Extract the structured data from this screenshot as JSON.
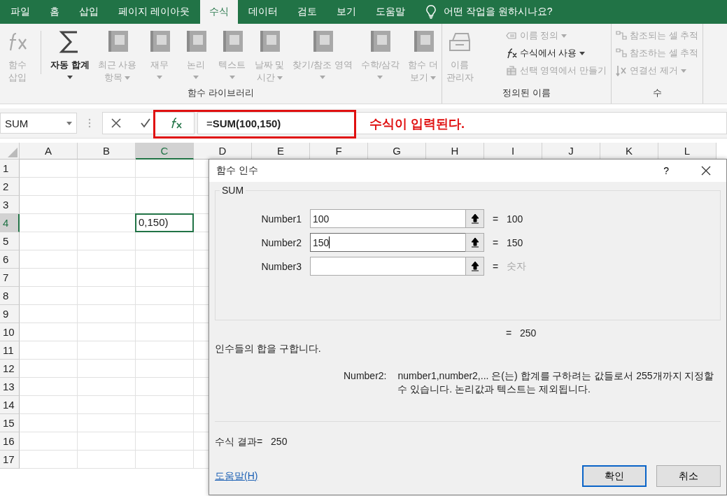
{
  "tabs": [
    {
      "label": "파일",
      "selected": false
    },
    {
      "label": "홈",
      "selected": false
    },
    {
      "label": "삽입",
      "selected": false
    },
    {
      "label": "페이지 레이아웃",
      "selected": false
    },
    {
      "label": "수식",
      "selected": true
    },
    {
      "label": "데이터",
      "selected": false
    },
    {
      "label": "검토",
      "selected": false
    },
    {
      "label": "보기",
      "selected": false
    },
    {
      "label": "도움말",
      "selected": false
    }
  ],
  "tell_me": {
    "placeholder": "어떤 작업을 원하시나요?"
  },
  "ribbon": {
    "groups": [
      {
        "label": "함수 라이브러리",
        "large": [
          {
            "kind": "fx",
            "lines": [
              "함수",
              "삽입"
            ],
            "dropdown": false,
            "disabled": true,
            "separator_after": true
          },
          {
            "kind": "sigma",
            "lines": [
              "자동 합계"
            ],
            "dropdown": true,
            "disabled": false,
            "separator_after": false
          },
          {
            "kind": "book",
            "lines": [
              "최근 사용",
              "항목"
            ],
            "dropdown": true,
            "disabled": true,
            "separator_after": false
          },
          {
            "kind": "book",
            "lines": [
              "재무"
            ],
            "dropdown": true,
            "disabled": true,
            "separator_after": false
          },
          {
            "kind": "book",
            "lines": [
              "논리"
            ],
            "dropdown": true,
            "disabled": true,
            "separator_after": false
          },
          {
            "kind": "book",
            "lines": [
              "텍스트"
            ],
            "dropdown": true,
            "disabled": true,
            "separator_after": false
          },
          {
            "kind": "book",
            "lines": [
              "날짜 및",
              "시간"
            ],
            "dropdown": true,
            "disabled": true,
            "separator_after": false
          },
          {
            "kind": "book",
            "lines": [
              "찾기/참조 영역"
            ],
            "dropdown": true,
            "disabled": true,
            "separator_after": false
          },
          {
            "kind": "book",
            "lines": [
              "수학/삼각"
            ],
            "dropdown": true,
            "disabled": true,
            "separator_after": false
          },
          {
            "kind": "book",
            "lines": [
              "함수 더",
              "보기"
            ],
            "dropdown": true,
            "disabled": true,
            "separator_after": false
          }
        ]
      },
      {
        "label": "정의된 이름",
        "large": [
          {
            "kind": "box",
            "lines": [
              "이름",
              "관리자"
            ],
            "dropdown": false,
            "disabled": true,
            "separator_after": false
          }
        ],
        "small": [
          {
            "kind": "tag",
            "label": "이름 정의",
            "dropdown": true,
            "disabled": true
          },
          {
            "kind": "fx",
            "label": "수식에서 사용",
            "dropdown": true,
            "disabled": false
          },
          {
            "kind": "grid",
            "label": "선택 영역에서 만들기",
            "dropdown": false,
            "disabled": true
          }
        ]
      },
      {
        "label": "수",
        "small": [
          {
            "kind": "trace",
            "label": "참조되는 셀 추적",
            "dropdown": false,
            "disabled": true
          },
          {
            "kind": "trace",
            "label": "참조하는 셀 추적",
            "dropdown": false,
            "disabled": true
          },
          {
            "kind": "remove",
            "label": "연결선 제거",
            "dropdown": true,
            "disabled": true
          }
        ]
      }
    ]
  },
  "formula_bar": {
    "name_box": "SUM",
    "formula": "=**SUM(100,150)**"
  },
  "annotation": {
    "text": "수식이 입력된다."
  },
  "sheet": {
    "columns": [
      {
        "label": "A",
        "selected": false
      },
      {
        "label": "B",
        "selected": false
      },
      {
        "label": "C",
        "selected": true
      },
      {
        "label": "D",
        "selected": false
      },
      {
        "label": "E",
        "selected": false
      },
      {
        "label": "F",
        "selected": false
      },
      {
        "label": "G",
        "selected": false
      },
      {
        "label": "H",
        "selected": false
      },
      {
        "label": "I",
        "selected": false
      },
      {
        "label": "J",
        "selected": false
      },
      {
        "label": "K",
        "selected": false
      },
      {
        "label": "L",
        "selected": false
      }
    ],
    "rows": [
      {
        "label": "1",
        "selected": false
      },
      {
        "label": "2",
        "selected": false
      },
      {
        "label": "3",
        "selected": false
      },
      {
        "label": "4",
        "selected": true
      },
      {
        "label": "5",
        "selected": false
      },
      {
        "label": "6",
        "selected": false
      },
      {
        "label": "7",
        "selected": false
      },
      {
        "label": "8",
        "selected": false
      },
      {
        "label": "9",
        "selected": false
      },
      {
        "label": "10",
        "selected": false
      },
      {
        "label": "11",
        "selected": false
      },
      {
        "label": "12",
        "selected": false
      },
      {
        "label": "13",
        "selected": false
      },
      {
        "label": "14",
        "selected": false
      },
      {
        "label": "15",
        "selected": false
      },
      {
        "label": "16",
        "selected": false
      },
      {
        "label": "17",
        "selected": false
      }
    ],
    "active_cell": {
      "text": "0,150)"
    }
  },
  "dialog": {
    "title": "함수 인수",
    "help": "?",
    "function": "SUM",
    "arguments": [
      {
        "label": "Number1",
        "value": "100",
        "focused": false,
        "sign": "=",
        "result": "100",
        "result_muted": false
      },
      {
        "label": "Number2",
        "value": "150",
        "focused": true,
        "sign": "=",
        "result": "150",
        "result_muted": false
      },
      {
        "label": "Number3",
        "focused": false,
        "sign": "=",
        "result": "숫자",
        "result_muted": true
      }
    ],
    "total": {
      "sign": "=",
      "value": "250"
    },
    "description": "인수들의 합을 구합니다.",
    "param_help": {
      "name": "Number2:",
      "text": "number1,number2,... 은(는) 합계를 구하려는 값들로서 255개까지 지정할 수 있습니다. 논리값과 텍스트는 제외됩니다."
    },
    "result": {
      "label": "수식 결과=",
      "value": "250"
    },
    "help_link": "도움말(H)",
    "buttons": [
      {
        "label": "확인",
        "default": true
      },
      {
        "label": "취소",
        "default": false
      }
    ]
  }
}
